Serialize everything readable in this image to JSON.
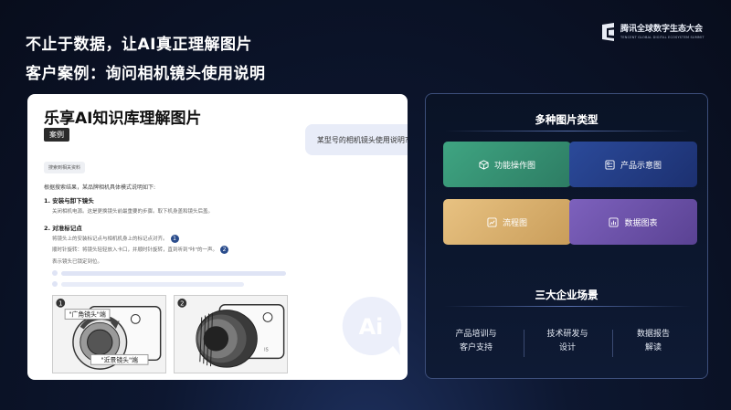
{
  "header": {
    "headline_1": "不止于数据，让AI真正理解图片",
    "headline_2": "客户案例：询问相机镜头使用说明",
    "logo_cn": "腾讯全球数字生态大会",
    "logo_en": "TENCENT GLOBAL DIGITAL ECOSYSTEM SUMMIT"
  },
  "demo_card": {
    "title": "乐享AI知识库理解图片",
    "case_tag": "案例",
    "user_question": "某型号的相机镜头使用说明?",
    "search_tag": "搜索到相关资料",
    "intro": "根据搜索结果，某品牌相机具体模式说明如下:",
    "step1_title": "1. 安装与卸下镜头",
    "step1_text": "关闭相机电源。这是更换镜头前最重要的步骤。取下机身盖和镜头后盖。",
    "step2_title": "2. 对准标记点",
    "step2_line1": "将镜头上的安装标记点与相机机身上的标记点对齐。",
    "step2_num1": "1",
    "step2_line2": "顺时针旋转：将镜头轻轻放入卡口，并顺时针旋转，直到听到\"咔\"的一声。",
    "step2_num2": "2",
    "step2_line3": "表示镜头已锁定到位。",
    "illus1_num": "1",
    "illus1_label_wide": "\"广角镜头\"端",
    "illus1_label_near": "\"近景镜头\"端",
    "illus2_num": "2",
    "illus2_lens_mark": "IS",
    "ai_mark_text": "Ai"
  },
  "panel": {
    "image_types_title": "多种图片类型",
    "tiles": [
      {
        "label": "功能操作图",
        "icon": "cube-icon"
      },
      {
        "label": "产品示意图",
        "icon": "product-card-icon"
      },
      {
        "label": "流程图",
        "icon": "trend-chart-icon"
      },
      {
        "label": "数据图表",
        "icon": "bar-chart-icon"
      }
    ],
    "scenarios_title": "三大企业场景",
    "scenarios": [
      {
        "line1": "产品培训与",
        "line2": "客户支持"
      },
      {
        "line1": "技术研发与",
        "line2": "设计"
      },
      {
        "line1": "数据报告",
        "line2": "解读"
      }
    ]
  }
}
